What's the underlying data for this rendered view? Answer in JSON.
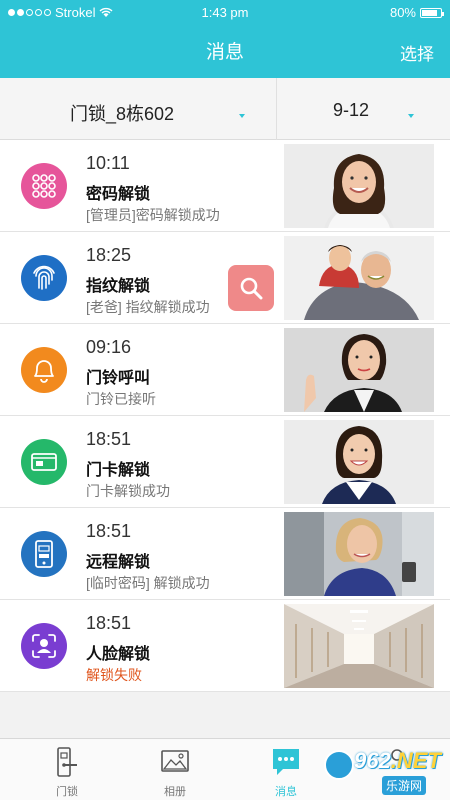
{
  "status": {
    "carrier": "Strokel",
    "time": "1:43 pm",
    "battery": "80%"
  },
  "nav": {
    "title": "消息",
    "right": "选择"
  },
  "filter": {
    "lock": "门锁_8栋602",
    "date": "9-12"
  },
  "records": [
    {
      "time": "10:11",
      "title": "密码解锁",
      "desc": "[管理员]密码解锁成功",
      "icon": "keypad-icon",
      "color": "#e6559a",
      "status": "ok"
    },
    {
      "time": "18:25",
      "title": "指纹解锁",
      "desc": "[老爸] 指纹解锁成功",
      "icon": "fingerprint-icon",
      "color": "#1f6fc5",
      "status": "ok"
    },
    {
      "time": "09:16",
      "title": "门铃呼叫",
      "desc": "门铃已接听",
      "icon": "bell-icon",
      "color": "#f28a1e",
      "status": "ok"
    },
    {
      "time": "18:51",
      "title": "门卡解锁",
      "desc": "门卡解锁成功",
      "icon": "card-icon",
      "color": "#25b86a",
      "status": "ok"
    },
    {
      "time": "18:51",
      "title": "远程解锁",
      "desc": "[临时密码] 解锁成功",
      "icon": "phone-icon",
      "color": "#2473c0",
      "status": "ok"
    },
    {
      "time": "18:51",
      "title": "人脸解锁",
      "desc": "解锁失败",
      "icon": "face-icon",
      "color": "#7a3dd1",
      "status": "fail"
    }
  ],
  "tabs": [
    {
      "label": "门锁",
      "icon": "door-lock-icon"
    },
    {
      "label": "相册",
      "icon": "album-icon"
    },
    {
      "label": "消息",
      "icon": "message-icon",
      "active": true
    },
    {
      "label": "",
      "icon": "user-icon"
    }
  ],
  "watermark": {
    "num_a": "962",
    "num_b": ".NET",
    "sub": "乐游网"
  },
  "colors": {
    "accent": "#2ec4d6",
    "fail": "#e0561e"
  }
}
